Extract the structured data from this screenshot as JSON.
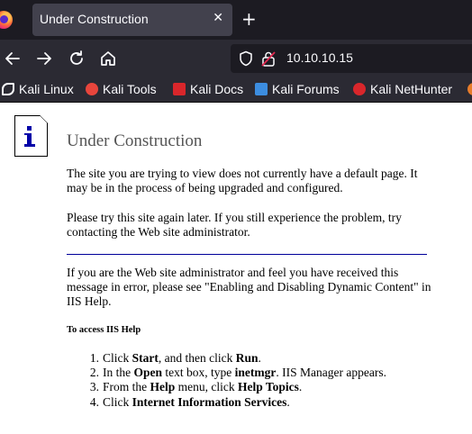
{
  "browser": {
    "tab": {
      "title": "Under Construction",
      "close_glyph": "✕"
    },
    "new_tab_glyph": "+",
    "url": "10.10.10.15",
    "bookmarks": [
      {
        "label": "Kali Linux",
        "icon": "kali-dragon-icon",
        "color": "#ffffff"
      },
      {
        "label": "Kali Tools",
        "icon": "kali-tools-icon",
        "color": "#e8453c"
      },
      {
        "label": "Kali Docs",
        "icon": "kali-docs-icon",
        "color": "#d9262b"
      },
      {
        "label": "Kali Forums",
        "icon": "kali-forums-icon",
        "color": "#3c8de0"
      },
      {
        "label": "Kali NetHunter",
        "icon": "nethunter-icon",
        "color": "#d9262b"
      }
    ]
  },
  "page": {
    "heading": "Under Construction",
    "para1": "The site you are trying to view does not currently have a default page. It may be in the process of being upgraded and configured.",
    "para2": "Please try this site again later. If you still experience the problem, try contacting the Web site administrator.",
    "para3": "If you are the Web site administrator and feel you have received this message in error, please see \"Enabling and Disabling Dynamic Content\" in IIS Help.",
    "iis_help_heading": "To access IIS Help",
    "steps": [
      {
        "num": "1.",
        "t1": "Click ",
        "b1": "Start",
        "t2": ", and then click ",
        "b2": "Run",
        "t3": "."
      },
      {
        "num": "2.",
        "t1": "In the ",
        "b1": "Open",
        "t2": " text box, type ",
        "b2": "inetmgr",
        "t3": ". IIS Manager appears."
      },
      {
        "num": "3.",
        "t1": "From the ",
        "b1": "Help",
        "t2": " menu, click ",
        "b2": "Help Topics",
        "t3": "."
      },
      {
        "num": "4.",
        "t1": "Click ",
        "b1": "Internet Information Services",
        "t2": ".",
        "b2": "",
        "t3": ""
      }
    ]
  },
  "colors": {
    "tabbar": "#1c1b22",
    "toolbar": "#2b2a33",
    "rule": "#000099",
    "heading": "#555555",
    "icon_blue": "#0000a8"
  }
}
